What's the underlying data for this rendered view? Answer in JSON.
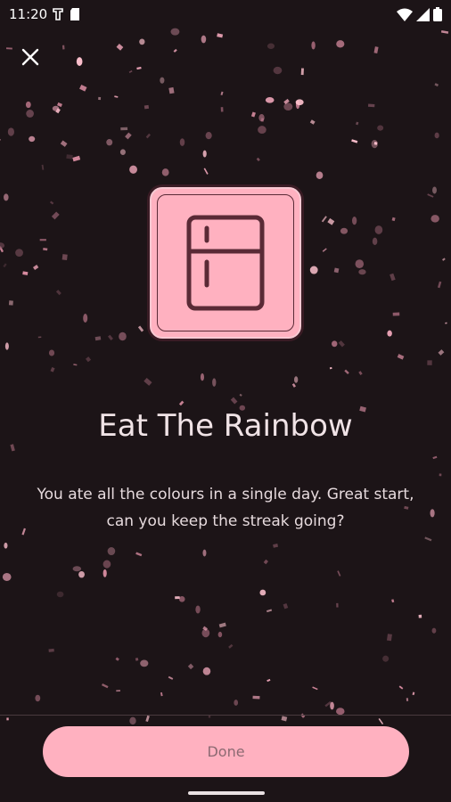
{
  "status_bar": {
    "time": "11:20"
  },
  "icons": {
    "close": "close-icon",
    "badge": "fridge-icon",
    "wifi": "wifi-icon",
    "signal": "signal-icon",
    "battery": "battery-icon"
  },
  "achievement": {
    "title": "Eat The Rainbow",
    "description": "You ate all the colours in a single day. Great start, can you keep the streak going?"
  },
  "actions": {
    "done_label": "Done"
  },
  "colors": {
    "background": "#1c1417",
    "accent": "#ffb1c0",
    "accent_text": "#8c6a72",
    "icon_stroke": "#5a2a36"
  }
}
